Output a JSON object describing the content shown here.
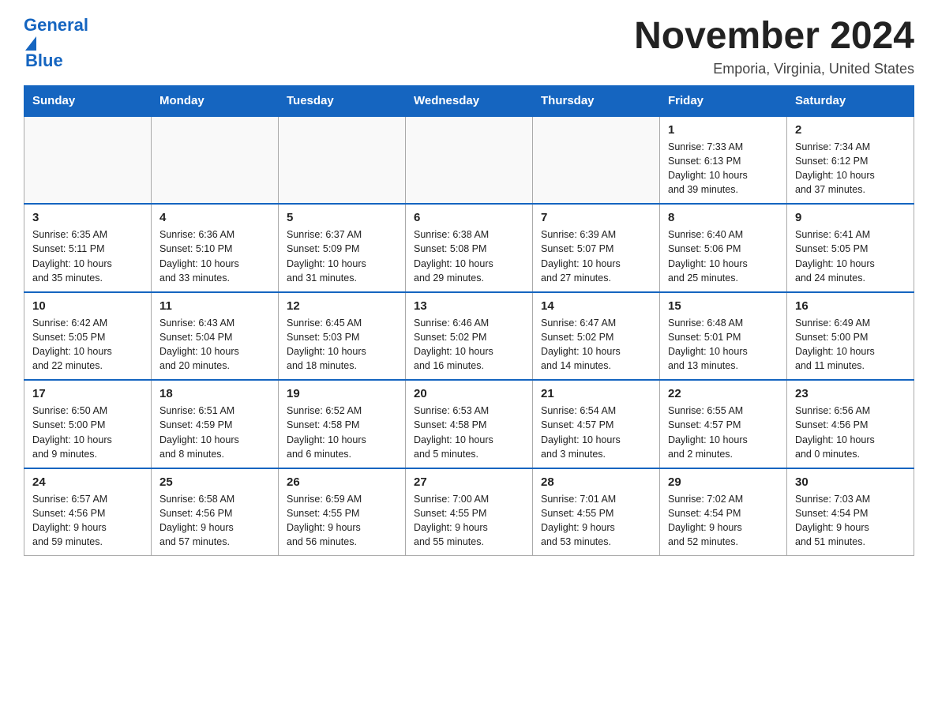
{
  "header": {
    "logo_line1": "General",
    "logo_line2": "Blue",
    "month_title": "November 2024",
    "location": "Emporia, Virginia, United States"
  },
  "weekdays": [
    "Sunday",
    "Monday",
    "Tuesday",
    "Wednesday",
    "Thursday",
    "Friday",
    "Saturday"
  ],
  "weeks": [
    [
      {
        "day": "",
        "info": ""
      },
      {
        "day": "",
        "info": ""
      },
      {
        "day": "",
        "info": ""
      },
      {
        "day": "",
        "info": ""
      },
      {
        "day": "",
        "info": ""
      },
      {
        "day": "1",
        "info": "Sunrise: 7:33 AM\nSunset: 6:13 PM\nDaylight: 10 hours\nand 39 minutes."
      },
      {
        "day": "2",
        "info": "Sunrise: 7:34 AM\nSunset: 6:12 PM\nDaylight: 10 hours\nand 37 minutes."
      }
    ],
    [
      {
        "day": "3",
        "info": "Sunrise: 6:35 AM\nSunset: 5:11 PM\nDaylight: 10 hours\nand 35 minutes."
      },
      {
        "day": "4",
        "info": "Sunrise: 6:36 AM\nSunset: 5:10 PM\nDaylight: 10 hours\nand 33 minutes."
      },
      {
        "day": "5",
        "info": "Sunrise: 6:37 AM\nSunset: 5:09 PM\nDaylight: 10 hours\nand 31 minutes."
      },
      {
        "day": "6",
        "info": "Sunrise: 6:38 AM\nSunset: 5:08 PM\nDaylight: 10 hours\nand 29 minutes."
      },
      {
        "day": "7",
        "info": "Sunrise: 6:39 AM\nSunset: 5:07 PM\nDaylight: 10 hours\nand 27 minutes."
      },
      {
        "day": "8",
        "info": "Sunrise: 6:40 AM\nSunset: 5:06 PM\nDaylight: 10 hours\nand 25 minutes."
      },
      {
        "day": "9",
        "info": "Sunrise: 6:41 AM\nSunset: 5:05 PM\nDaylight: 10 hours\nand 24 minutes."
      }
    ],
    [
      {
        "day": "10",
        "info": "Sunrise: 6:42 AM\nSunset: 5:05 PM\nDaylight: 10 hours\nand 22 minutes."
      },
      {
        "day": "11",
        "info": "Sunrise: 6:43 AM\nSunset: 5:04 PM\nDaylight: 10 hours\nand 20 minutes."
      },
      {
        "day": "12",
        "info": "Sunrise: 6:45 AM\nSunset: 5:03 PM\nDaylight: 10 hours\nand 18 minutes."
      },
      {
        "day": "13",
        "info": "Sunrise: 6:46 AM\nSunset: 5:02 PM\nDaylight: 10 hours\nand 16 minutes."
      },
      {
        "day": "14",
        "info": "Sunrise: 6:47 AM\nSunset: 5:02 PM\nDaylight: 10 hours\nand 14 minutes."
      },
      {
        "day": "15",
        "info": "Sunrise: 6:48 AM\nSunset: 5:01 PM\nDaylight: 10 hours\nand 13 minutes."
      },
      {
        "day": "16",
        "info": "Sunrise: 6:49 AM\nSunset: 5:00 PM\nDaylight: 10 hours\nand 11 minutes."
      }
    ],
    [
      {
        "day": "17",
        "info": "Sunrise: 6:50 AM\nSunset: 5:00 PM\nDaylight: 10 hours\nand 9 minutes."
      },
      {
        "day": "18",
        "info": "Sunrise: 6:51 AM\nSunset: 4:59 PM\nDaylight: 10 hours\nand 8 minutes."
      },
      {
        "day": "19",
        "info": "Sunrise: 6:52 AM\nSunset: 4:58 PM\nDaylight: 10 hours\nand 6 minutes."
      },
      {
        "day": "20",
        "info": "Sunrise: 6:53 AM\nSunset: 4:58 PM\nDaylight: 10 hours\nand 5 minutes."
      },
      {
        "day": "21",
        "info": "Sunrise: 6:54 AM\nSunset: 4:57 PM\nDaylight: 10 hours\nand 3 minutes."
      },
      {
        "day": "22",
        "info": "Sunrise: 6:55 AM\nSunset: 4:57 PM\nDaylight: 10 hours\nand 2 minutes."
      },
      {
        "day": "23",
        "info": "Sunrise: 6:56 AM\nSunset: 4:56 PM\nDaylight: 10 hours\nand 0 minutes."
      }
    ],
    [
      {
        "day": "24",
        "info": "Sunrise: 6:57 AM\nSunset: 4:56 PM\nDaylight: 9 hours\nand 59 minutes."
      },
      {
        "day": "25",
        "info": "Sunrise: 6:58 AM\nSunset: 4:56 PM\nDaylight: 9 hours\nand 57 minutes."
      },
      {
        "day": "26",
        "info": "Sunrise: 6:59 AM\nSunset: 4:55 PM\nDaylight: 9 hours\nand 56 minutes."
      },
      {
        "day": "27",
        "info": "Sunrise: 7:00 AM\nSunset: 4:55 PM\nDaylight: 9 hours\nand 55 minutes."
      },
      {
        "day": "28",
        "info": "Sunrise: 7:01 AM\nSunset: 4:55 PM\nDaylight: 9 hours\nand 53 minutes."
      },
      {
        "day": "29",
        "info": "Sunrise: 7:02 AM\nSunset: 4:54 PM\nDaylight: 9 hours\nand 52 minutes."
      },
      {
        "day": "30",
        "info": "Sunrise: 7:03 AM\nSunset: 4:54 PM\nDaylight: 9 hours\nand 51 minutes."
      }
    ]
  ]
}
